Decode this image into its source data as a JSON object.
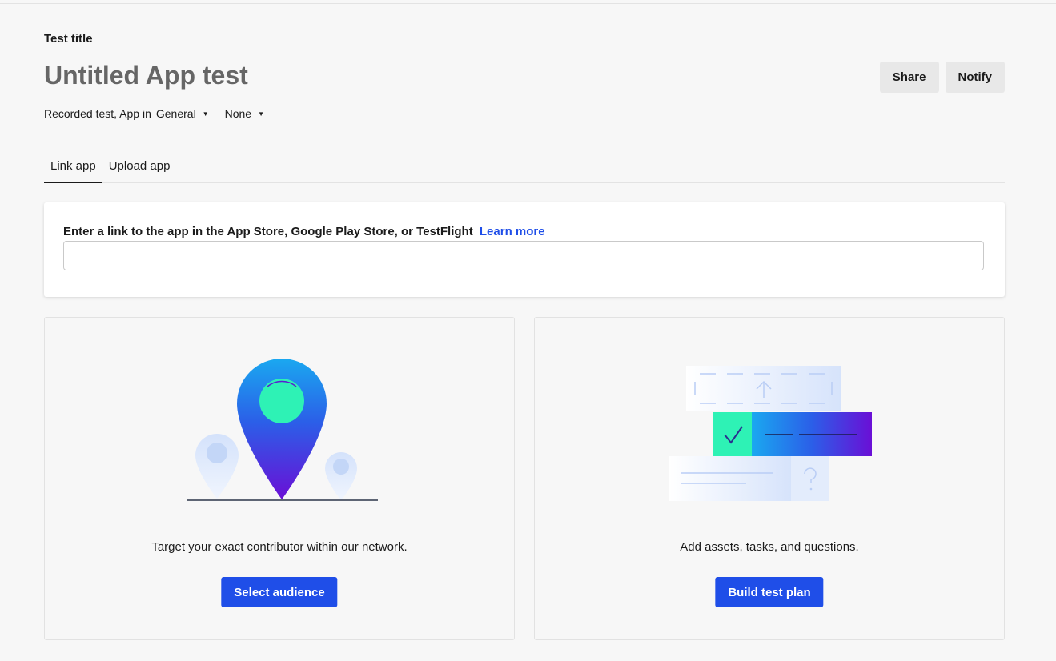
{
  "header": {
    "title_label": "Test title",
    "title_value": "Untitled App test",
    "share_label": "Share",
    "notify_label": "Notify"
  },
  "meta": {
    "prefix": "Recorded test, App in",
    "folder": "General",
    "secondary": "None"
  },
  "tabs": [
    {
      "label": "Link app",
      "active": true
    },
    {
      "label": "Upload app",
      "active": false
    }
  ],
  "link_card": {
    "label": "Enter a link to the app in the App Store, Google Play Store, or TestFlight",
    "learn_more": "Learn more",
    "input_value": "",
    "input_placeholder": ""
  },
  "panels": {
    "audience": {
      "caption": "Target your exact contributor within our network.",
      "button": "Select audience",
      "icon": "location-pin-icon"
    },
    "plan": {
      "caption": "Add assets, tasks, and questions.",
      "button": "Build test plan",
      "icon": "test-plan-icon"
    }
  },
  "colors": {
    "primary": "#1f4ee8",
    "accent_green": "#2ef2b5",
    "accent_purple": "#6a0fd6"
  }
}
